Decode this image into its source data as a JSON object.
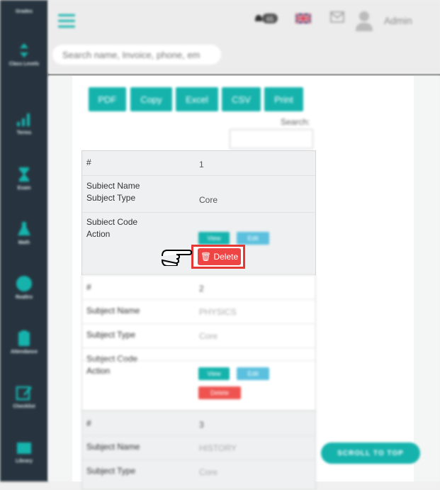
{
  "sidebar": {
    "items": [
      {
        "label": "Grades",
        "icon": "grades-icon"
      },
      {
        "label": "Class Levels",
        "icon": "class-levels-icon"
      },
      {
        "label": "Terms",
        "icon": "terms-icon"
      },
      {
        "label": "Exam",
        "icon": "exam-icon"
      },
      {
        "label": "Math",
        "icon": "flask-icon"
      },
      {
        "label": "Realtro",
        "icon": "circle-icon"
      },
      {
        "label": "Attendance",
        "icon": "clipboard-icon"
      },
      {
        "label": "Checklist",
        "icon": "edit-icon"
      },
      {
        "label": "Library",
        "icon": "library-icon"
      }
    ]
  },
  "header": {
    "search_placeholder": "Search name, Invoice, phone, em",
    "notification_count": "65",
    "user": "Admin"
  },
  "toolbar": {
    "buttons": [
      "PDF",
      "Copy",
      "Excel",
      "CSV",
      "Print"
    ],
    "search_label": "Search:"
  },
  "labels": {
    "num": "#",
    "subject_name": "Subject Name",
    "subject_type": "Subject Type",
    "subject_code": "Subject Code",
    "action": "Action"
  },
  "actions": {
    "view": "View",
    "edit": "Edit",
    "delete": "Delete"
  },
  "rows": [
    {
      "num": "1",
      "subject_name": "",
      "subject_type": "Core",
      "subject_code": ""
    },
    {
      "num": "2",
      "subject_name": "PHYSICS",
      "subject_type": "Core",
      "subject_code": ""
    },
    {
      "num": "3",
      "subject_name": "HISTORY",
      "subject_type": "Core",
      "subject_code": ""
    }
  ],
  "scroll_top": "SCROLL TO TOP",
  "colors": {
    "sidebar": "#27343f",
    "accent": "#16b3ad",
    "danger": "#ef4444"
  }
}
